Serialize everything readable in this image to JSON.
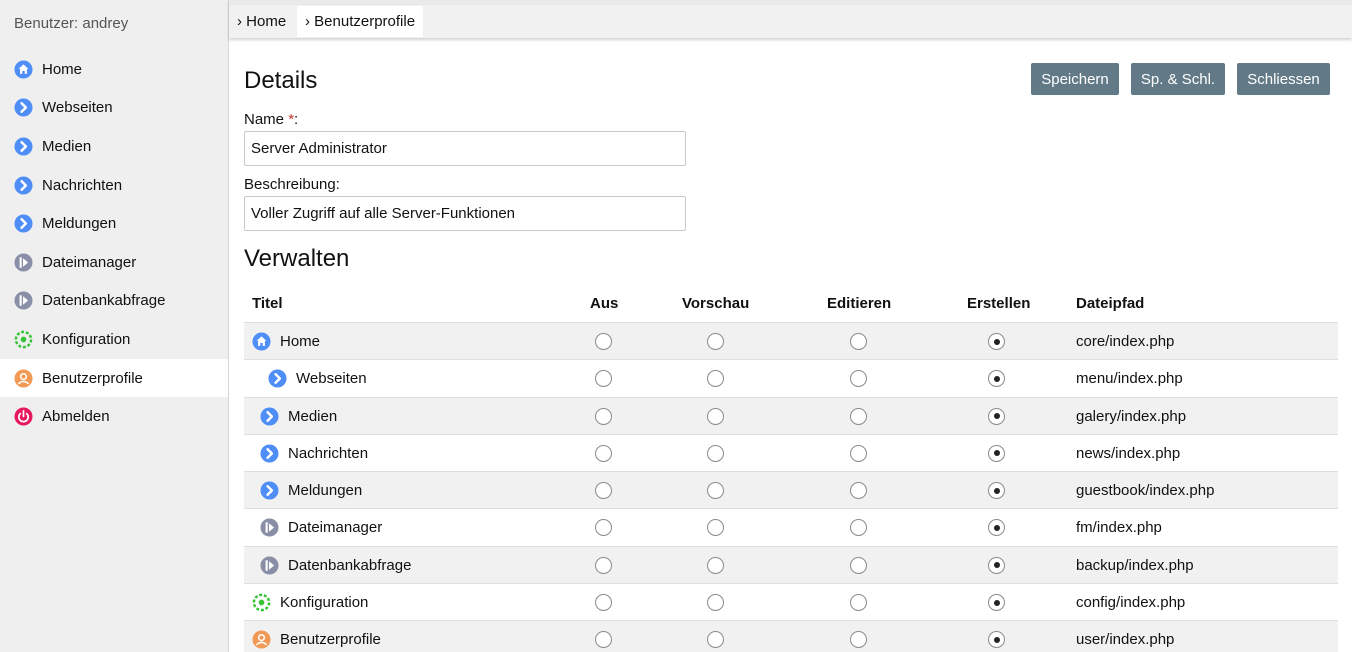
{
  "sidebar": {
    "user_label": "Benutzer: andrey",
    "items": [
      {
        "label": "Home",
        "icon": "home-icon"
      },
      {
        "label": "Webseiten",
        "icon": "chevron-right-icon"
      },
      {
        "label": "Medien",
        "icon": "chevron-right-icon"
      },
      {
        "label": "Nachrichten",
        "icon": "chevron-right-icon"
      },
      {
        "label": "Meldungen",
        "icon": "chevron-right-icon"
      },
      {
        "label": "Dateimanager",
        "icon": "file-manager-icon"
      },
      {
        "label": "Datenbankabfrage",
        "icon": "database-query-icon"
      },
      {
        "label": "Konfiguration",
        "icon": "gear-icon"
      },
      {
        "label": "Benutzerprofile",
        "icon": "user-icon",
        "active": true
      },
      {
        "label": "Abmelden",
        "icon": "power-icon"
      }
    ]
  },
  "breadcrumb": [
    "› Home",
    "› Benutzerprofile"
  ],
  "details": {
    "heading": "Details",
    "buttons": {
      "save": "Speichern",
      "save_close": "Sp. & Schl.",
      "close": "Schliessen"
    },
    "name_label": "Name ",
    "required_mark": "*",
    "name_colon": ":",
    "name_value": "Server Administrator",
    "desc_label": "Beschreibung:",
    "desc_value": "Voller Zugriff auf alle Server-Funktionen"
  },
  "manage": {
    "heading": "Verwalten",
    "columns": [
      "Titel",
      "Aus",
      "Vorschau",
      "Editieren",
      "Erstellen",
      "Dateipfad"
    ],
    "options": [
      "Aus",
      "Vorschau",
      "Editieren",
      "Erstellen"
    ],
    "rows": [
      {
        "title": "Home",
        "icon": "home-icon",
        "level": 0,
        "selected": "Erstellen",
        "path": "core/index.php"
      },
      {
        "title": "Webseiten",
        "icon": "chevron-right-icon",
        "level": 2,
        "selected": "Erstellen",
        "path": "menu/index.php"
      },
      {
        "title": "Medien",
        "icon": "chevron-right-icon",
        "level": 1,
        "selected": "Erstellen",
        "path": "galery/index.php"
      },
      {
        "title": "Nachrichten",
        "icon": "chevron-right-icon",
        "level": 1,
        "selected": "Erstellen",
        "path": "news/index.php"
      },
      {
        "title": "Meldungen",
        "icon": "chevron-right-icon",
        "level": 1,
        "selected": "Erstellen",
        "path": "guestbook/index.php"
      },
      {
        "title": "Dateimanager",
        "icon": "file-manager-icon",
        "level": 1,
        "selected": "Erstellen",
        "path": "fm/index.php"
      },
      {
        "title": "Datenbankabfrage",
        "icon": "database-query-icon",
        "level": 1,
        "selected": "Erstellen",
        "path": "backup/index.php"
      },
      {
        "title": "Konfiguration",
        "icon": "gear-icon",
        "level": 0,
        "selected": "Erstellen",
        "path": "config/index.php"
      },
      {
        "title": "Benutzerprofile",
        "icon": "user-icon",
        "level": 0,
        "selected": "Erstellen",
        "path": "user/index.php"
      }
    ]
  },
  "colors": {
    "button_bg": "#627a87",
    "sidebar_bg": "#efefef",
    "row_alt_bg": "#f1f1f1",
    "icon_blue": "#4f8ef7",
    "icon_gray": "#8a8fa8",
    "icon_green": "#35c435",
    "icon_orange": "#f29a55",
    "icon_pink": "#e6185f",
    "required": "#c0392b"
  }
}
